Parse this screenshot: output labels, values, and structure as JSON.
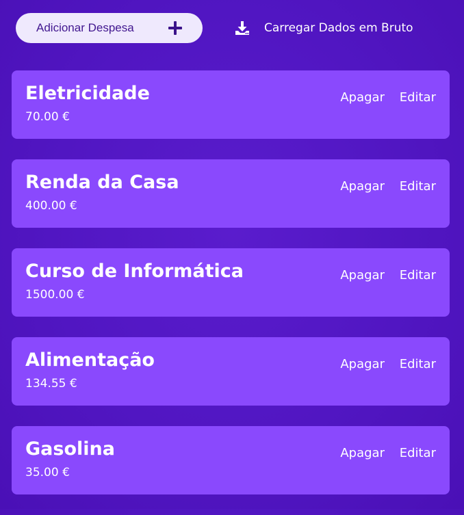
{
  "toolbar": {
    "add_expense_label": "Adicionar Despesa",
    "add_icon": "plus-icon",
    "download_label": "Carregar Dados em Bruto",
    "download_icon": "download-icon"
  },
  "expenses": [
    {
      "name": "Eletricidade",
      "amount": "70.00 €",
      "delete_label": "Apagar",
      "edit_label": "Editar"
    },
    {
      "name": "Renda da Casa",
      "amount": "400.00 €",
      "delete_label": "Apagar",
      "edit_label": "Editar"
    },
    {
      "name": "Curso de Informática",
      "amount": "1500.00 €",
      "delete_label": "Apagar",
      "edit_label": "Editar"
    },
    {
      "name": "Alimentação",
      "amount": "134.55 €",
      "delete_label": "Apagar",
      "edit_label": "Editar"
    },
    {
      "name": "Gasolina",
      "amount": "35.00 €",
      "delete_label": "Apagar",
      "edit_label": "Editar"
    }
  ],
  "colors": {
    "background": "#5116c2",
    "card": "#8a49fd",
    "add_button_bg": "#efe9fd",
    "add_button_text": "#41178f",
    "text": "#ffffff"
  }
}
